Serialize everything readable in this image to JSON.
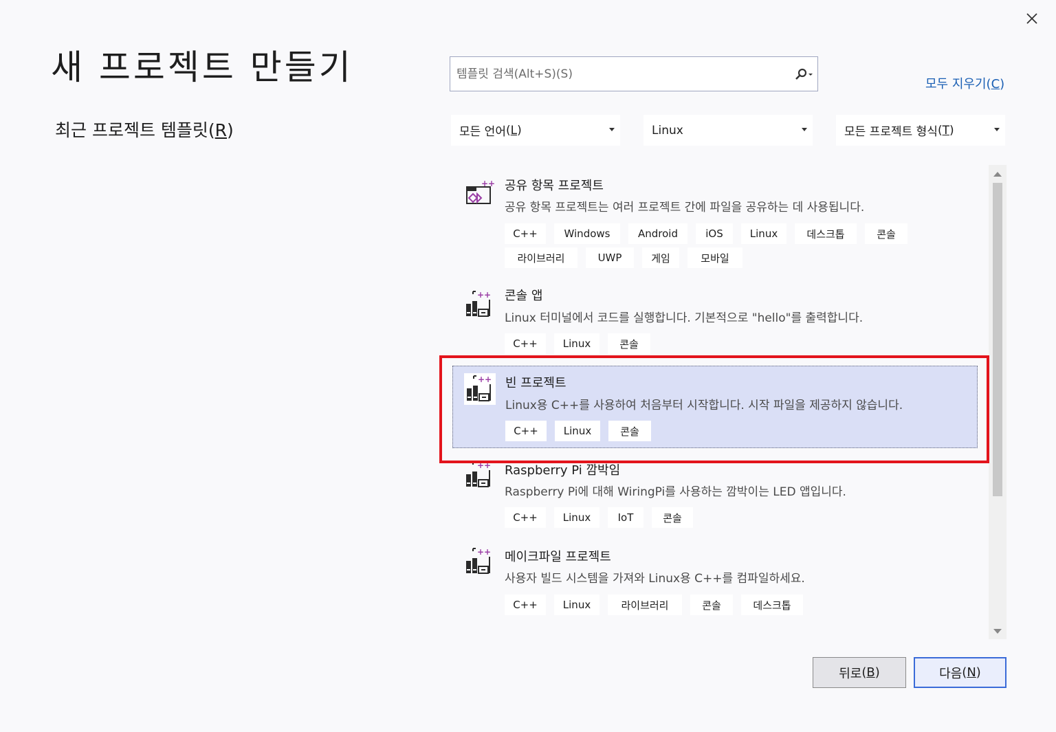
{
  "page": {
    "title": "새 프로젝트 만들기",
    "recent_title_text": "최근 프로젝트 템플릿",
    "recent_title_key": "R"
  },
  "search": {
    "placeholder": "템플릿 검색(Alt+S)(S)"
  },
  "clear_all": {
    "text": "모두 지우기",
    "key": "C"
  },
  "filters": {
    "language": {
      "text": "모든 언어",
      "key": "L"
    },
    "platform": {
      "text": "Linux"
    },
    "project_type": {
      "text": "모든 프로젝트 형식",
      "key": "T"
    }
  },
  "templates": [
    {
      "name": "공유 항목 프로젝트",
      "description": "공유 항목 프로젝트는 여러 프로젝트 간에 파일을 공유하는 데 사용됩니다.",
      "icon": "shared-items-icon",
      "tags": [
        "C++",
        "Windows",
        "Android",
        "iOS",
        "Linux",
        "데스크톱",
        "콘솔",
        "라이브러리",
        "UWP",
        "게임",
        "모바일"
      ]
    },
    {
      "name": "콘솔 앱",
      "description": "Linux 터미널에서 코드를 실행합니다. 기본적으로 \"hello\"를 출력합니다.",
      "icon": "cpp-console-icon",
      "tags": [
        "C++",
        "Linux",
        "콘솔"
      ]
    },
    {
      "name": "빈 프로젝트",
      "description": "Linux용 C++를 사용하여 처음부터 시작합니다. 시작 파일을 제공하지 않습니다.",
      "icon": "cpp-console-icon",
      "selected": true,
      "tags": [
        "C++",
        "Linux",
        "콘솔"
      ]
    },
    {
      "name": "Raspberry Pi 깜박임",
      "description": "Raspberry Pi에 대해 WiringPi를 사용하는 깜박이는 LED 앱입니다.",
      "icon": "cpp-console-icon",
      "tags": [
        "C++",
        "Linux",
        "IoT",
        "콘솔"
      ]
    },
    {
      "name": "메이크파일 프로젝트",
      "description": "사용자 빌드 시스템을 가져와 Linux용 C++를 컴파일하세요.",
      "icon": "cpp-console-icon",
      "tags": [
        "C++",
        "Linux",
        "라이브러리",
        "콘솔",
        "데스크톱"
      ]
    }
  ],
  "buttons": {
    "back": {
      "text": "뒤로",
      "key": "B"
    },
    "next": {
      "text": "다음",
      "key": "N"
    }
  },
  "colors": {
    "accent": "#1a5fb4",
    "selected_bg": "#dadff6",
    "highlight_red": "#e3141c",
    "icon_purple": "#9b3fa6"
  }
}
